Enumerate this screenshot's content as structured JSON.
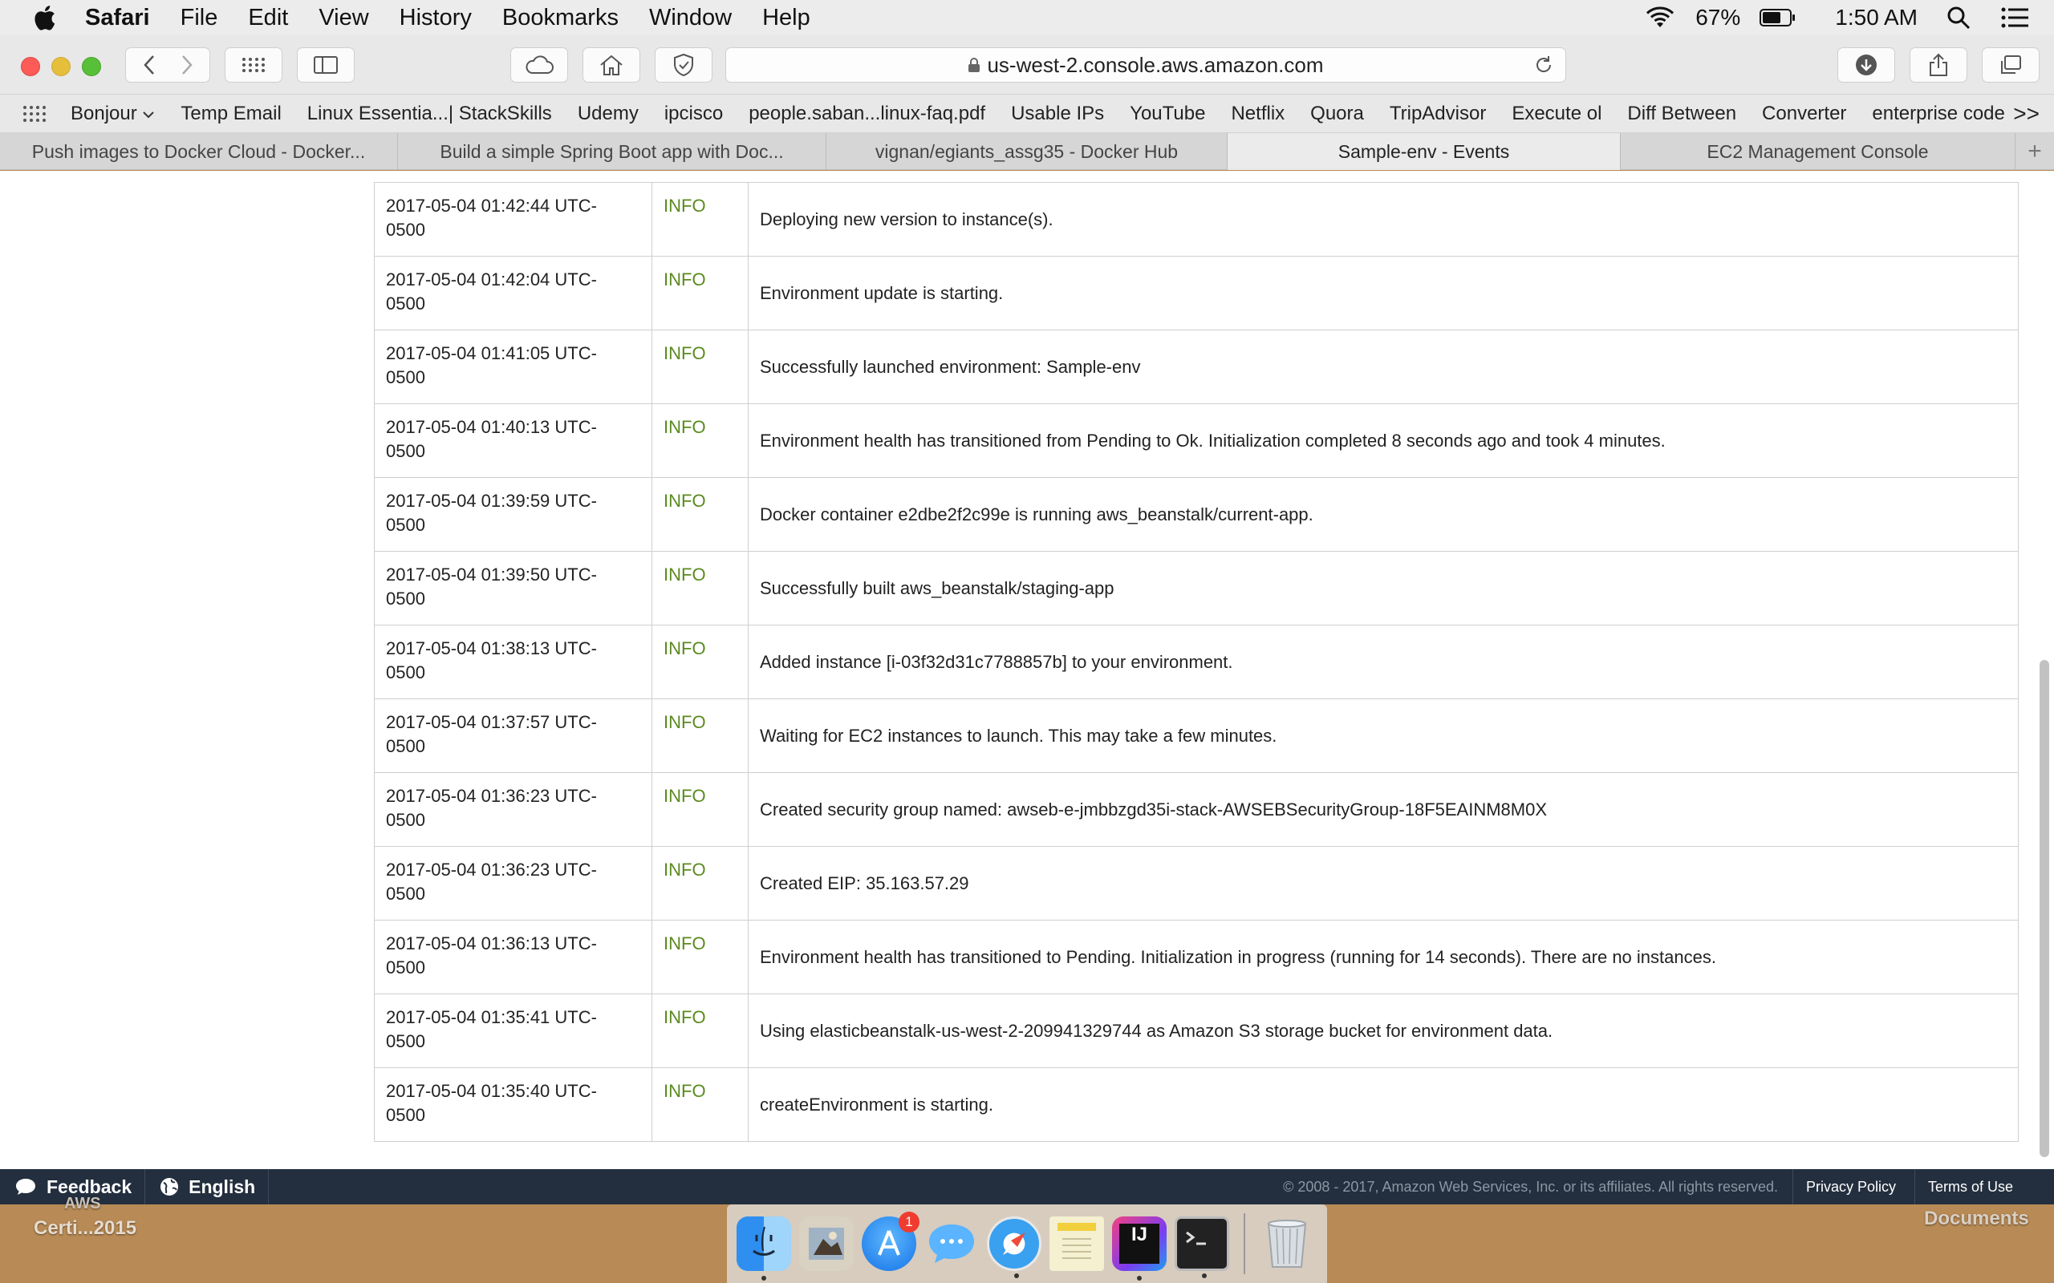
{
  "menubar": {
    "app": "Safari",
    "items": [
      "File",
      "Edit",
      "View",
      "History",
      "Bookmarks",
      "Window",
      "Help"
    ],
    "battery": "67%",
    "time": "1:50 AM"
  },
  "toolbar": {
    "url": "us-west-2.console.aws.amazon.com"
  },
  "bookmarks": {
    "items": [
      "Bonjour",
      "Temp Email",
      "Linux Essentia...| StackSkills",
      "Udemy",
      "ipcisco",
      "people.saban...linux-faq.pdf",
      "Usable IPs",
      "YouTube",
      "Netflix",
      "Quora",
      "TripAdvisor",
      "Execute ol",
      "Diff Between",
      "Converter",
      "enterprise code"
    ],
    "more": ">>"
  },
  "tabs": [
    {
      "label": "Push images to Docker Cloud - Docker..."
    },
    {
      "label": "Build a simple Spring Boot app with Doc..."
    },
    {
      "label": "vignan/egiants_assg35 - Docker Hub"
    },
    {
      "label": "Sample-env - Events"
    },
    {
      "label": "EC2 Management Console"
    }
  ],
  "events": [
    {
      "time": "2017-05-04 01:42:44 UTC-0500",
      "time_line1": "2017-05-04 01:42:44 UTC-",
      "time_line2": "0500",
      "severity": "INFO",
      "message": "Deploying new version to instance(s)."
    },
    {
      "time": "2017-05-04 01:42:04 UTC-0500",
      "time_line1": "2017-05-04 01:42:04 UTC-",
      "time_line2": "0500",
      "severity": "INFO",
      "message": "Environment update is starting."
    },
    {
      "time": "2017-05-04 01:41:05 UTC-0500",
      "time_line1": "2017-05-04 01:41:05 UTC-",
      "time_line2": "0500",
      "severity": "INFO",
      "message": "Successfully launched environment: Sample-env"
    },
    {
      "time": "2017-05-04 01:40:13 UTC-0500",
      "time_line1": "2017-05-04 01:40:13 UTC-",
      "time_line2": "0500",
      "severity": "INFO",
      "message": "Environment health has transitioned from Pending to Ok. Initialization completed 8 seconds ago and took 4 minutes."
    },
    {
      "time": "2017-05-04 01:39:59 UTC-0500",
      "time_line1": "2017-05-04 01:39:59 UTC-",
      "time_line2": "0500",
      "severity": "INFO",
      "message": "Docker container e2dbe2f2c99e is running aws_beanstalk/current-app."
    },
    {
      "time": "2017-05-04 01:39:50 UTC-0500",
      "time_line1": "2017-05-04 01:39:50 UTC-",
      "time_line2": "0500",
      "severity": "INFO",
      "message": "Successfully built aws_beanstalk/staging-app"
    },
    {
      "time": "2017-05-04 01:38:13 UTC-0500",
      "time_line1": "2017-05-04 01:38:13 UTC-",
      "time_line2": "0500",
      "severity": "INFO",
      "message": "Added instance [i-03f32d31c7788857b] to your environment."
    },
    {
      "time": "2017-05-04 01:37:57 UTC-0500",
      "time_line1": "2017-05-04 01:37:57 UTC-",
      "time_line2": "0500",
      "severity": "INFO",
      "message": "Waiting for EC2 instances to launch. This may take a few minutes."
    },
    {
      "time": "2017-05-04 01:36:23 UTC-0500",
      "time_line1": "2017-05-04 01:36:23 UTC-",
      "time_line2": "0500",
      "severity": "INFO",
      "message": "Created security group named: awseb-e-jmbbzgd35i-stack-AWSEBSecurityGroup-18F5EAINM8M0X"
    },
    {
      "time": "2017-05-04 01:36:23 UTC-0500",
      "time_line1": "2017-05-04 01:36:23 UTC-",
      "time_line2": "0500",
      "severity": "INFO",
      "message": "Created EIP: 35.163.57.29"
    },
    {
      "time": "2017-05-04 01:36:13 UTC-0500",
      "time_line1": "2017-05-04 01:36:13 UTC-",
      "time_line2": "0500",
      "severity": "INFO",
      "message": "Environment health has transitioned to Pending. Initialization in progress (running for 14 seconds). There are no instances."
    },
    {
      "time": "2017-05-04 01:35:41 UTC-0500",
      "time_line1": "2017-05-04 01:35:41 UTC-",
      "time_line2": "0500",
      "severity": "INFO",
      "message": "Using elasticbeanstalk-us-west-2-209941329744 as Amazon S3 storage bucket for environment data."
    },
    {
      "time": "2017-05-04 01:35:40 UTC-0500",
      "time_line1": "2017-05-04 01:35:40 UTC-",
      "time_line2": "0500",
      "severity": "INFO",
      "message": "createEnvironment is starting."
    }
  ],
  "footer": {
    "feedback": "Feedback",
    "language": "English",
    "copyright": "© 2008 - 2017, Amazon Web Services, Inc. or its affiliates. All rights reserved.",
    "privacy": "Privacy Policy",
    "terms": "Terms of Use"
  },
  "desktop": {
    "left_label_line1": "AWS",
    "left_label_line2": "Certi...2015",
    "right_label": "Documents"
  },
  "dock": {
    "items": [
      "finder-icon",
      "preview-icon",
      "app-store-icon",
      "messages-icon",
      "safari-icon",
      "notes-icon",
      "intellij-icon",
      "terminal-icon",
      "trash-icon"
    ],
    "app_store_badge": "1",
    "intellij_label": "IJ"
  },
  "colors": {
    "severity_info": "#5a8a1f",
    "footer_bg": "#232f3e"
  }
}
